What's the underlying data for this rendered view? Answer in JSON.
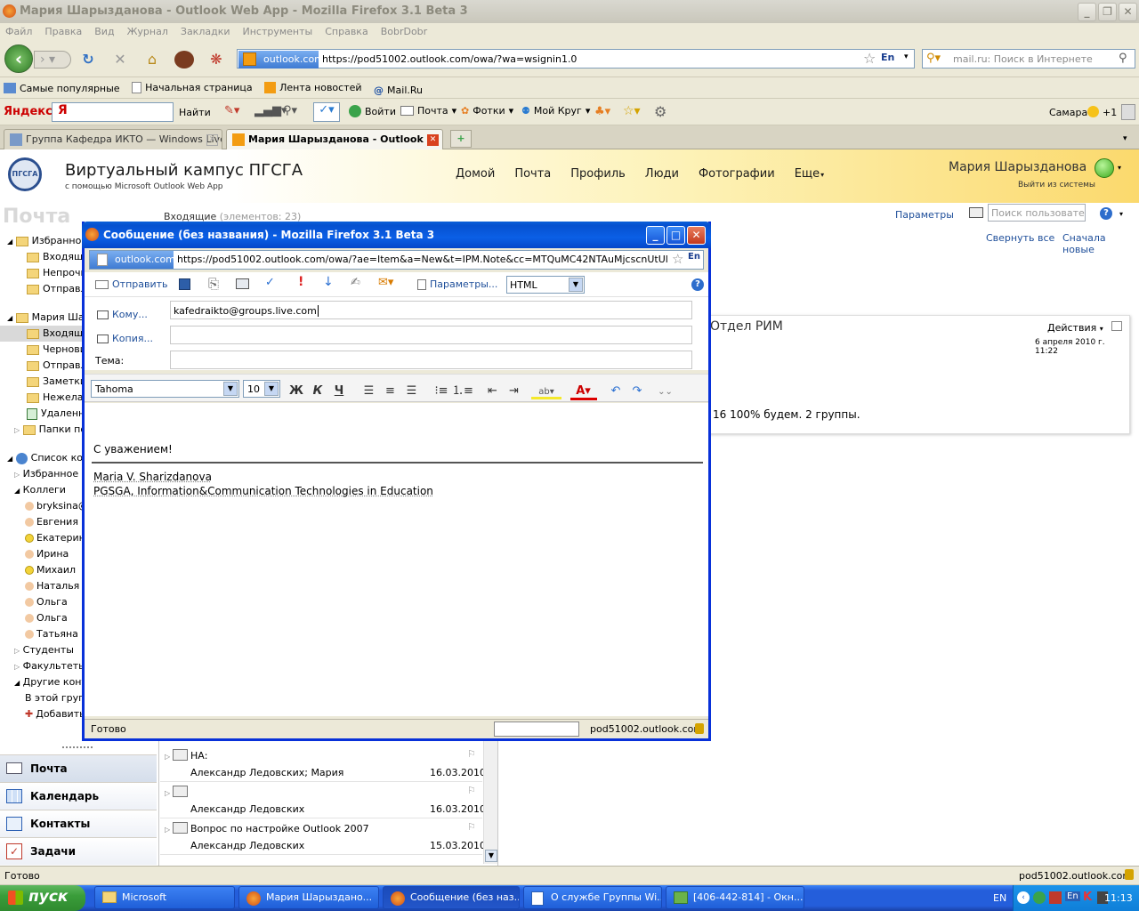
{
  "window": {
    "title": "Мария Шарызданова - Outlook Web App - Mozilla Firefox 3.1 Beta 3"
  },
  "menubar": [
    "Файл",
    "Правка",
    "Вид",
    "Журнал",
    "Закладки",
    "Инструменты",
    "Справка",
    "BobrDobr"
  ],
  "navbar": {
    "site_badge": "outlook.com",
    "url": "https://pod51002.outlook.com/owa/?wa=wsignin1.0",
    "lang": "En",
    "search_placeholder": "mail.ru: Поиск в Интернете"
  },
  "bookmarks": [
    "Самые популярные",
    "Начальная страница",
    "Лента новостей",
    "Mail.Ru"
  ],
  "yandex": {
    "logo": "Яндекс",
    "find": "Найти",
    "login": "Войти",
    "mail": "Почта",
    "photos": "Фотки",
    "circle": "Мой Круг",
    "city": "Самара",
    "temp": "+1"
  },
  "tabs": [
    {
      "label": "Группа Кафедра ИКТО — Windows Live",
      "active": false
    },
    {
      "label": "Мария Шарызданова - Outlook ...",
      "active": true
    }
  ],
  "owa": {
    "brand_title": "Виртуальный кампус ПГСГА",
    "brand_sub": "с помощью Microsoft Outlook Web App",
    "nav": [
      "Домой",
      "Почта",
      "Профиль",
      "Люди",
      "Фотографии",
      "Еще"
    ],
    "user": "Мария Шарызданова",
    "signout": "Выйти из системы",
    "section_title": "Почта",
    "inbox_title": "Входящие",
    "inbox_count": "(элементов: 23)",
    "params": "Параметры",
    "user_search_placeholder": "Поиск пользователя",
    "collapse_all": "Свернуть все",
    "newest_first": "Сначала новые",
    "status": "Готово",
    "status_host": "pod51002.outlook.com"
  },
  "sidebar": {
    "items": [
      "Избранное",
      "Входящие",
      "Непрочитанные",
      "Отправленные",
      "Мария Шарызданова",
      "Входящие",
      "Черновики",
      "Отправленные",
      "Заметки",
      "Нежелательная",
      "Удаленные",
      "Папки поиска",
      "Список контактов",
      "Избранное",
      "Коллеги",
      "bryksina@",
      "Евгения",
      "Екатерина",
      "Ирина",
      "Михаил",
      "Наталья",
      "Ольга",
      "Ольга",
      "Татьяна",
      "Студенты",
      "Факультеты",
      "Другие контакты",
      "В этой группе",
      "Добавить"
    ],
    "big_nav": [
      "Почта",
      "Календарь",
      "Контакты",
      "Задачи"
    ]
  },
  "messages": [
    {
      "subject": "НА:",
      "from": "Александр Ледовских; Мария",
      "date": "16.03.2010"
    },
    {
      "subject": "",
      "from": "Александр Ледовских",
      "date": "16.03.2010"
    },
    {
      "subject": "Вопрос по настройке Outlook 2007",
      "from": "Александр Ледовских",
      "date": "15.03.2010"
    }
  ],
  "reading": {
    "sender": "Отдел РИМ",
    "actions": "Действия",
    "date": "6 апреля 2010 г. 11:22",
    "body": "16 100% будем. 2 группы."
  },
  "popup": {
    "title": "Сообщение (без названия) - Mozilla Firefox 3.1 Beta 3",
    "badge": "outlook.com",
    "url": "https://pod51002.outlook.com/owa/?ae=Item&a=New&t=IPM.Note&cc=MTQuMC42NTAuMjcscnUtUlUsNDI5NDk2N",
    "lang": "En",
    "send": "Отправить",
    "params": "Параметры...",
    "format": "HTML",
    "to_label": "Кому...",
    "to_value": "kafedraikto@groups.live.com",
    "cc_label": "Копия...",
    "subject_label": "Тема:",
    "font": "Tahoma",
    "size": "10",
    "bold": "Ж",
    "italic": "К",
    "underline": "Ч",
    "greeting": "С уважением!",
    "sig_name": "Maria V. Sharizdanova",
    "sig_org": "PGSGA, Information&Communication Technologies in Education",
    "status": "Готово",
    "status_host": "pod51002.outlook.com"
  },
  "taskbar": {
    "start": "пуск",
    "buttons": [
      "Microsoft",
      "Мария Шарызданo...",
      "Сообщение (без наз...",
      "О службе Группы Wi...",
      "[406-442-814] - Окн..."
    ],
    "lang": "EN",
    "time": "11:13"
  }
}
